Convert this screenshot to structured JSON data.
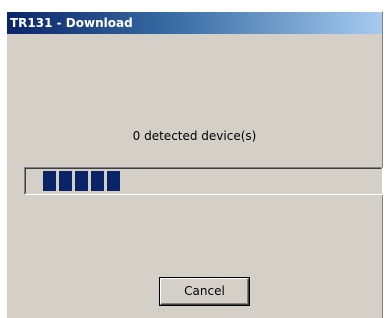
{
  "window": {
    "title": "TR131 - Download"
  },
  "status": {
    "text": "0 detected device(s)"
  },
  "progress": {
    "filled_chunks": 5,
    "chunk_color": "#0a246a"
  },
  "buttons": {
    "cancel_label": "Cancel"
  },
  "colors": {
    "dialog_bg": "#d4d0c8",
    "title_gradient_start": "#0a246a",
    "title_gradient_end": "#a6caf0"
  }
}
